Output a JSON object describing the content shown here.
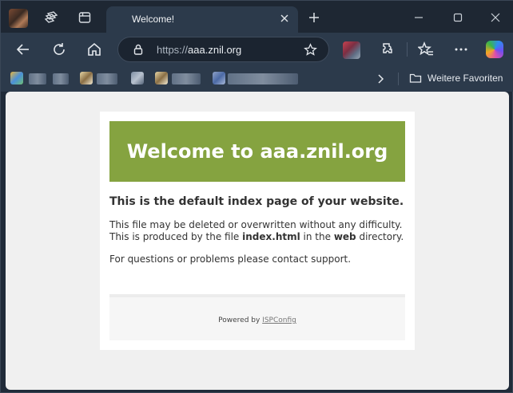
{
  "tab": {
    "title": "Welcome!"
  },
  "address_bar": {
    "protocol": "https://",
    "host": "aaa.znil.org"
  },
  "bookmarks_bar": {
    "favorites_label": "Weitere Favoriten"
  },
  "page": {
    "banner_title": "Welcome to aaa.znil.org",
    "headline": "This is the default index page of your website.",
    "line1": "This file may be deleted or overwritten without any difficulty.",
    "line2_pre": "This is produced by the file ",
    "line2_file": "index.html",
    "line2_mid": " in the ",
    "line2_dir": "web",
    "line2_post": " directory.",
    "support": "For questions or problems please contact support.",
    "footer_prefix": "Powered by ",
    "footer_link": "ISPConfig"
  },
  "colors": {
    "banner": "#85a340",
    "browser_chrome": "#2c3a4b",
    "page_bg": "#f0f0f0"
  },
  "icons": [
    "workspaces-icon",
    "tab-actions-icon",
    "close-icon",
    "plus-icon",
    "minimize-icon",
    "maximize-icon",
    "window-close-icon",
    "back-icon",
    "refresh-icon",
    "home-icon",
    "lock-icon",
    "star-icon",
    "extensions-icon",
    "favorites-icon",
    "more-icon",
    "copilot-icon",
    "chevron-right-icon",
    "folder-icon"
  ]
}
